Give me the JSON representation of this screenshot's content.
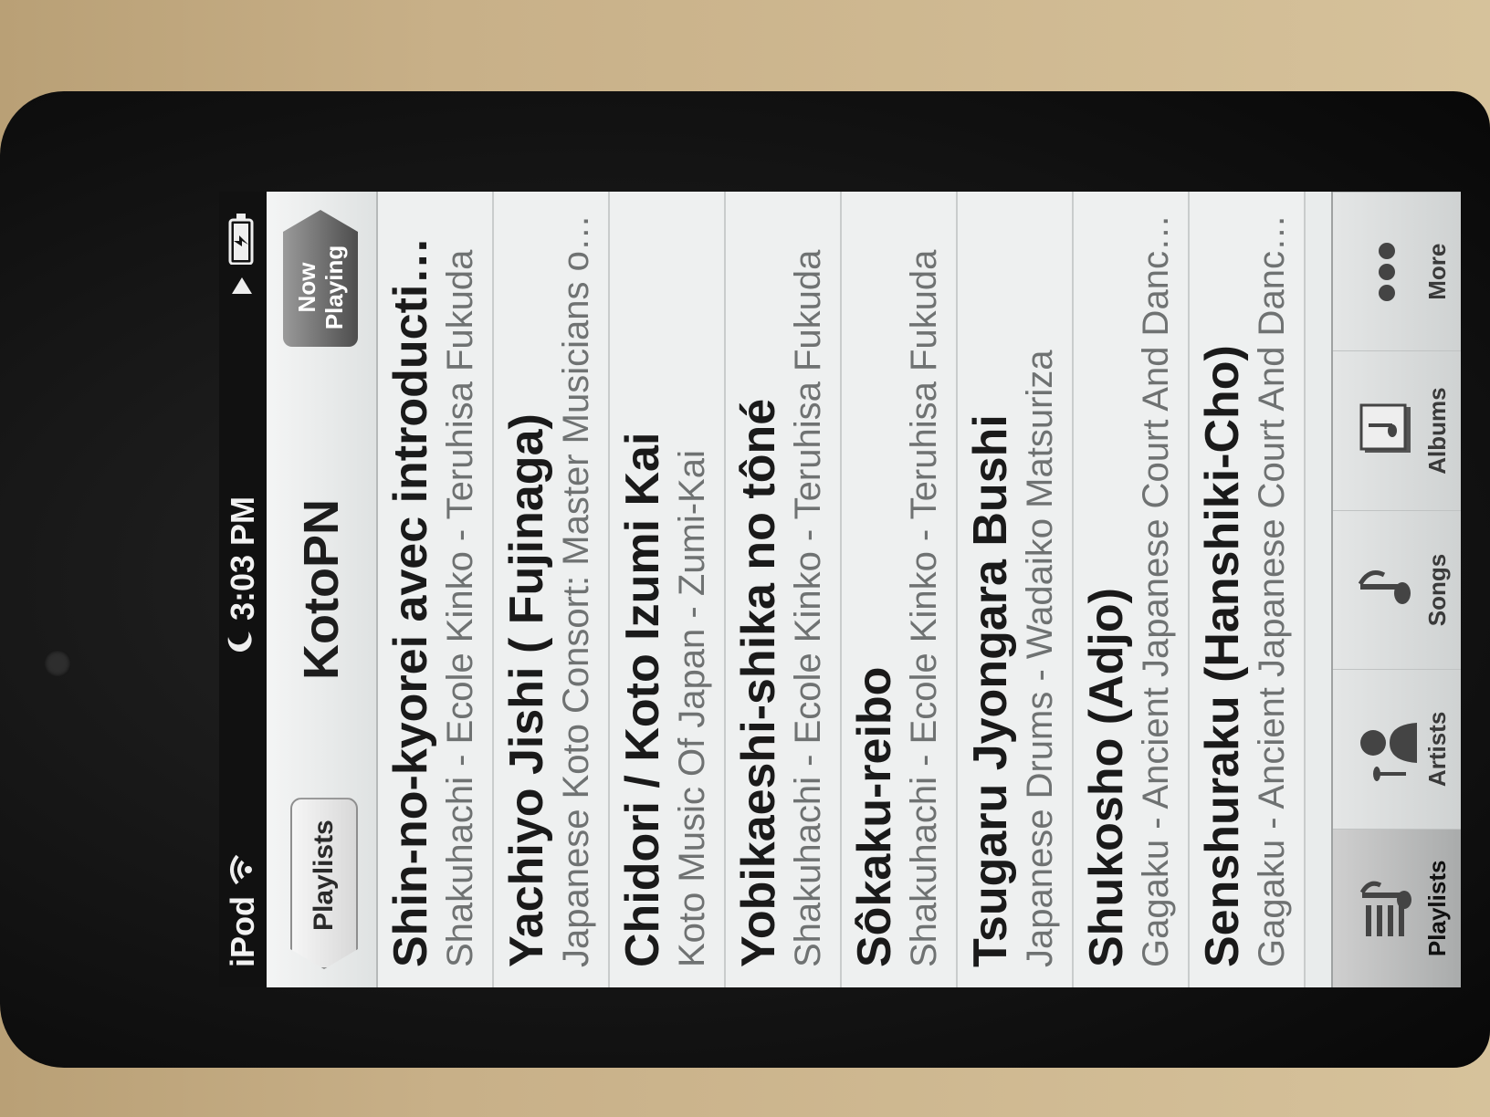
{
  "status_bar": {
    "carrier": "iPod",
    "time": "3:03 PM",
    "wifi_icon": "wifi-icon",
    "moon_icon": "moon-icon",
    "play_icon": "play-icon",
    "battery_icon": "battery-charging-icon"
  },
  "nav": {
    "title": "KotoPN",
    "back_label": "Playlists",
    "now_playing_line1": "Now",
    "now_playing_line2": "Playing"
  },
  "songs": [
    {
      "title": "Shin-no-kyorei avec introduction…",
      "subtitle": "Shakuhachi - Ecole Kinko - Teruhisa Fukuda"
    },
    {
      "title": "Yachiyo Jishi ( Fujinaga)",
      "subtitle": "Japanese Koto Consort: Master Musicians of…"
    },
    {
      "title": "Chidori / Koto Izumi Kai",
      "subtitle": "Koto Music Of Japan - Zumi-Kai"
    },
    {
      "title": "Yobikaeshi-shika no tôné",
      "subtitle": "Shakuhachi - Ecole Kinko - Teruhisa Fukuda"
    },
    {
      "title": "Sôkaku-reibo",
      "subtitle": "Shakuhachi - Ecole Kinko - Teruhisa Fukuda"
    },
    {
      "title": "Tsugaru Jyongara Bushi",
      "subtitle": "Japanese Drums - Wadaiko Matsuriza"
    },
    {
      "title": "Shukosho (Adjo)",
      "subtitle": "Gagaku - Ancient Japanese Court And Danc…"
    },
    {
      "title": "Senshuraku (Hanshiki-Cho)",
      "subtitle": "Gagaku - Ancient Japanese Court And Danc…"
    }
  ],
  "tabs": [
    {
      "label": "Playlists",
      "icon": "playlists-icon"
    },
    {
      "label": "Artists",
      "icon": "artists-icon"
    },
    {
      "label": "Songs",
      "icon": "songs-icon"
    },
    {
      "label": "Albums",
      "icon": "albums-icon"
    },
    {
      "label": "More",
      "icon": "more-icon"
    }
  ]
}
